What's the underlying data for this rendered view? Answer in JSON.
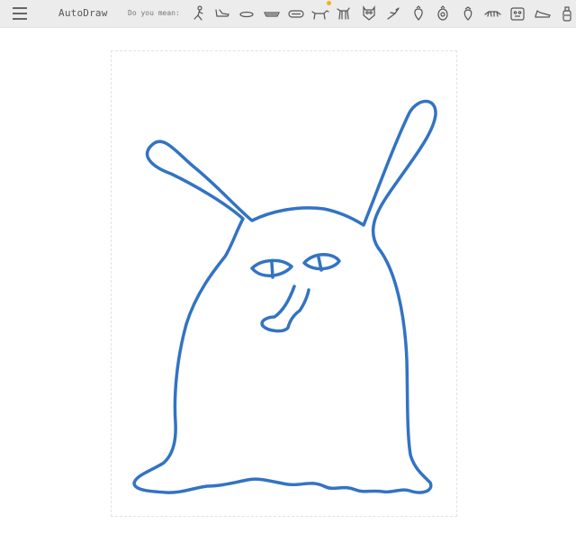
{
  "toolbar": {
    "app_title": "AutoDraw",
    "suggest_label": "Do you mean:",
    "menu_icon": "hamburger-menu-icon",
    "suggestions": [
      {
        "name": "suggestion-figure-icon"
      },
      {
        "name": "suggestion-shoe-icon"
      },
      {
        "name": "suggestion-oval-icon"
      },
      {
        "name": "suggestion-dish-icon"
      },
      {
        "name": "suggestion-bread-icon"
      },
      {
        "name": "suggestion-dog-icon",
        "highlighted": true
      },
      {
        "name": "suggestion-horse-icon"
      },
      {
        "name": "suggestion-owl-icon"
      },
      {
        "name": "suggestion-plant-icon"
      },
      {
        "name": "suggestion-strawberry-icon"
      },
      {
        "name": "suggestion-pineapple-icon"
      },
      {
        "name": "suggestion-berry-icon"
      },
      {
        "name": "suggestion-rabbit-icon"
      },
      {
        "name": "suggestion-cat-face-icon"
      },
      {
        "name": "suggestion-sneaker-icon"
      },
      {
        "name": "suggestion-bottle-icon"
      }
    ]
  },
  "colors": {
    "toolbar_bg": "#ececec",
    "stroke": "#3273c4",
    "highlight_dot": "#f2b21b",
    "icon": "#555555"
  }
}
